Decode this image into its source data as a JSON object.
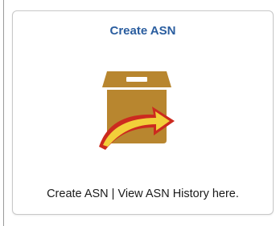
{
  "tile": {
    "title": "Create ASN",
    "caption": "Create ASN | View ASN History here.",
    "icon": "box-with-arrow-icon"
  },
  "colors": {
    "title": "#2a5d9f",
    "box": "#b8862f",
    "box_dark": "#9a6e24",
    "arrow_fill": "#f2cf3a",
    "arrow_outline": "#cc2a1f"
  }
}
